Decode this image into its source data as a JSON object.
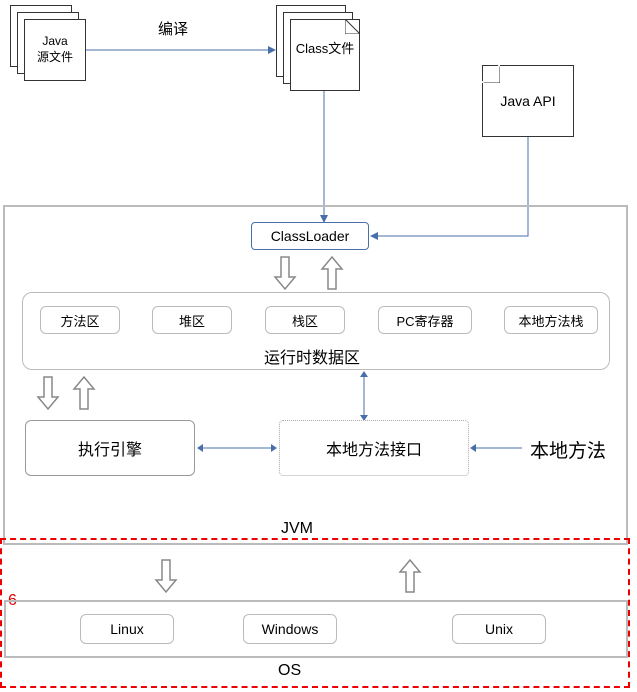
{
  "top": {
    "javaSource": "Java\n源文件",
    "compile": "编译",
    "classFile": "Class文件",
    "javaApi": "Java API"
  },
  "jvm": {
    "classLoader": "ClassLoader",
    "runtime": {
      "title": "运行时数据区",
      "methodArea": "方法区",
      "heap": "堆区",
      "stack": "栈区",
      "pcRegister": "PC寄存器",
      "nativeStack": "本地方法栈"
    },
    "executionEngine": "执行引擎",
    "nativeInterface": "本地方法接口",
    "nativeMethods": "本地方法",
    "label": "JVM"
  },
  "os": {
    "label": "OS",
    "linux": "Linux",
    "windows": "Windows",
    "unix": "Unix",
    "number": "6"
  }
}
